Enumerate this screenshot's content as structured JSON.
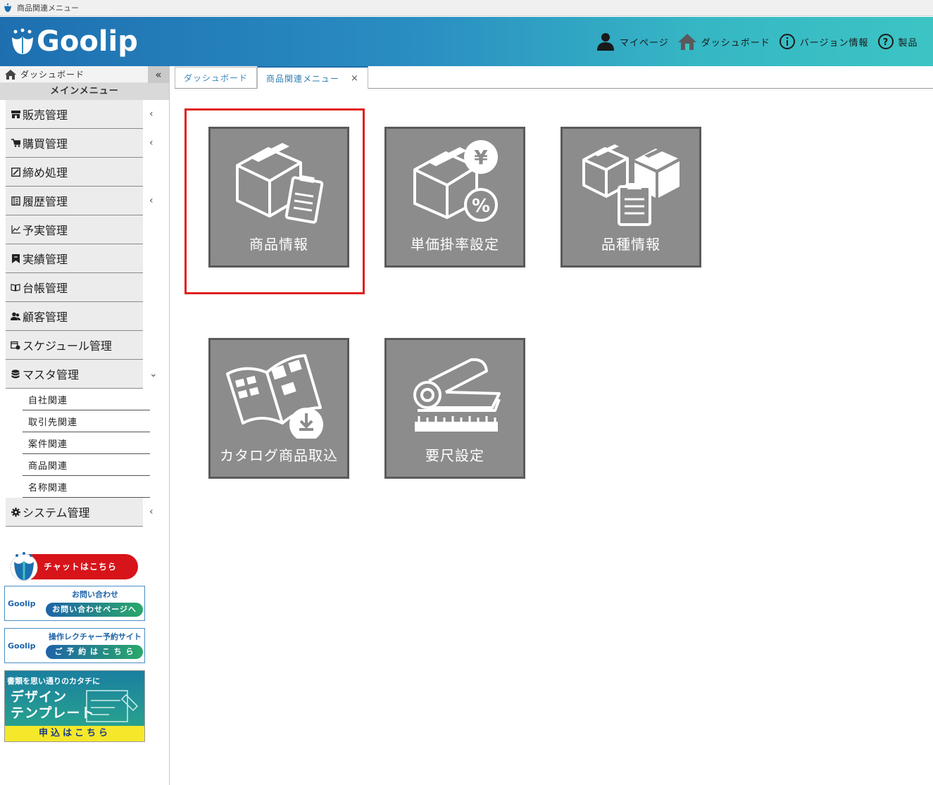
{
  "window": {
    "title": "商品関連メニュー"
  },
  "header": {
    "logo_text": "Goolip",
    "nav": [
      {
        "label": "マイページ",
        "icon": "user-icon"
      },
      {
        "label": "ダッシュボード",
        "icon": "home-icon"
      },
      {
        "label": "バージョン情報",
        "icon": "info-icon"
      },
      {
        "label": "製品",
        "icon": "help-icon"
      }
    ]
  },
  "sidebar": {
    "home_label": "ダッシュボード",
    "collapse_label": "«",
    "section_title": "メインメニュー",
    "items": [
      {
        "label": "販売管理",
        "chevron": "‹"
      },
      {
        "label": "購買管理",
        "chevron": "‹"
      },
      {
        "label": "締め処理",
        "chevron": ""
      },
      {
        "label": "履歴管理",
        "chevron": "‹"
      },
      {
        "label": "予実管理",
        "chevron": ""
      },
      {
        "label": "実績管理",
        "chevron": ""
      },
      {
        "label": "台帳管理",
        "chevron": ""
      },
      {
        "label": "顧客管理",
        "chevron": ""
      },
      {
        "label": "スケジュール管理",
        "chevron": ""
      },
      {
        "label": "マスタ管理",
        "chevron": "⌄"
      }
    ],
    "sub_items": [
      "自社関連",
      "取引先関連",
      "案件関連",
      "商品関連",
      "名称関連"
    ],
    "system_item": {
      "label": "システム管理",
      "chevron": "‹"
    }
  },
  "banners": {
    "chat": "チャットはこちら",
    "inquiry": {
      "logo": "Goolip",
      "title": "お問い合わせ",
      "button": "お問い合わせページへ"
    },
    "lecture": {
      "logo": "Goolip",
      "title": "操作レクチャー予約サイト",
      "button": "ご 予 約 は こ ち ら"
    },
    "design": {
      "line1": "書類を思い通りのカタチに",
      "line2": "デザイン",
      "line3": "テンプレート",
      "button": "申込はこちら"
    }
  },
  "tabs": [
    {
      "label": "ダッシュボード",
      "active": false
    },
    {
      "label": "商品関連メニュー",
      "active": true,
      "close": "×"
    }
  ],
  "tiles": [
    {
      "label": "商品情報",
      "icon": "box-clipboard-icon",
      "selected": true
    },
    {
      "label": "単価掛率設定",
      "icon": "box-yen-percent-icon",
      "selected": false
    },
    {
      "label": "品種情報",
      "icon": "boxes-clipboard-icon",
      "selected": false
    },
    {
      "label": "カタログ商品取込",
      "icon": "catalog-import-icon",
      "selected": false
    },
    {
      "label": "要尺設定",
      "icon": "fabric-roll-ruler-icon",
      "selected": false
    }
  ],
  "colors": {
    "header_start": "#1e6fb0",
    "header_end": "#3cc4c4",
    "tile_bg": "#8c8c8c",
    "tile_border": "#5a5a5a",
    "highlight": "#e02020"
  }
}
